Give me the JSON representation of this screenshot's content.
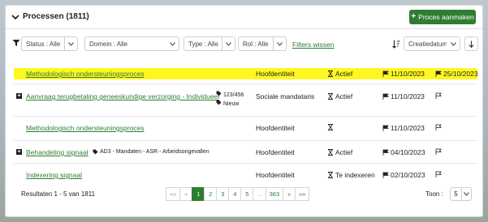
{
  "header": {
    "title": "Processen (1811)",
    "new_button": "Proces aanmaken"
  },
  "filters": {
    "status": "Status : Alle",
    "domein": "Domein : Alle",
    "type": "Type : Alle",
    "rol": "Rol : Alle",
    "clear": "Filters wissen",
    "sort": "Creatiedatum"
  },
  "rows": [
    {
      "name": "Methodologisch ondersteuningsproces",
      "identity": "Hoofdentiteit",
      "status": "Actief",
      "date_start": "11/10/2023",
      "date_end": "25/10/2023",
      "highlight": true
    },
    {
      "name": "Aanvraag terugbetaling geneeskundige verzorging - Individueel",
      "tag_count": "123/456",
      "tag_new": "Nieuw",
      "identity": "Sociale mandataris",
      "status": "Actief",
      "date_start": "11/10/2023",
      "date_end": ""
    },
    {
      "name": "Methodologisch ondersteuningsproces",
      "identity": "Hoofdentiteit",
      "status": "",
      "date_start": "11/10/2023",
      "date_end": ""
    },
    {
      "name": "Behandeling signaal",
      "tag_inline": "AD3 - Mandaten - ASR - Arbeidsongevallen",
      "identity": "Hoofdentiteit",
      "status": "Actief",
      "date_start": "04/10/2023",
      "date_end": ""
    },
    {
      "name": "Indexering signaal",
      "identity": "Hoofdentiteit",
      "status": "Te indexeren",
      "date_start": "02/10/2023",
      "date_end": ""
    }
  ],
  "footer": {
    "results": "Resultaten 1 - 5 van 1811",
    "pages": [
      "««",
      "«",
      "1",
      "2",
      "3",
      "4",
      "5",
      "...",
      "363",
      "»",
      "»»"
    ],
    "active_page": "1",
    "show_label": "Toon :",
    "show_value": "5"
  },
  "colors": {
    "accent": "#2e7d32",
    "highlight": "#fff720"
  }
}
